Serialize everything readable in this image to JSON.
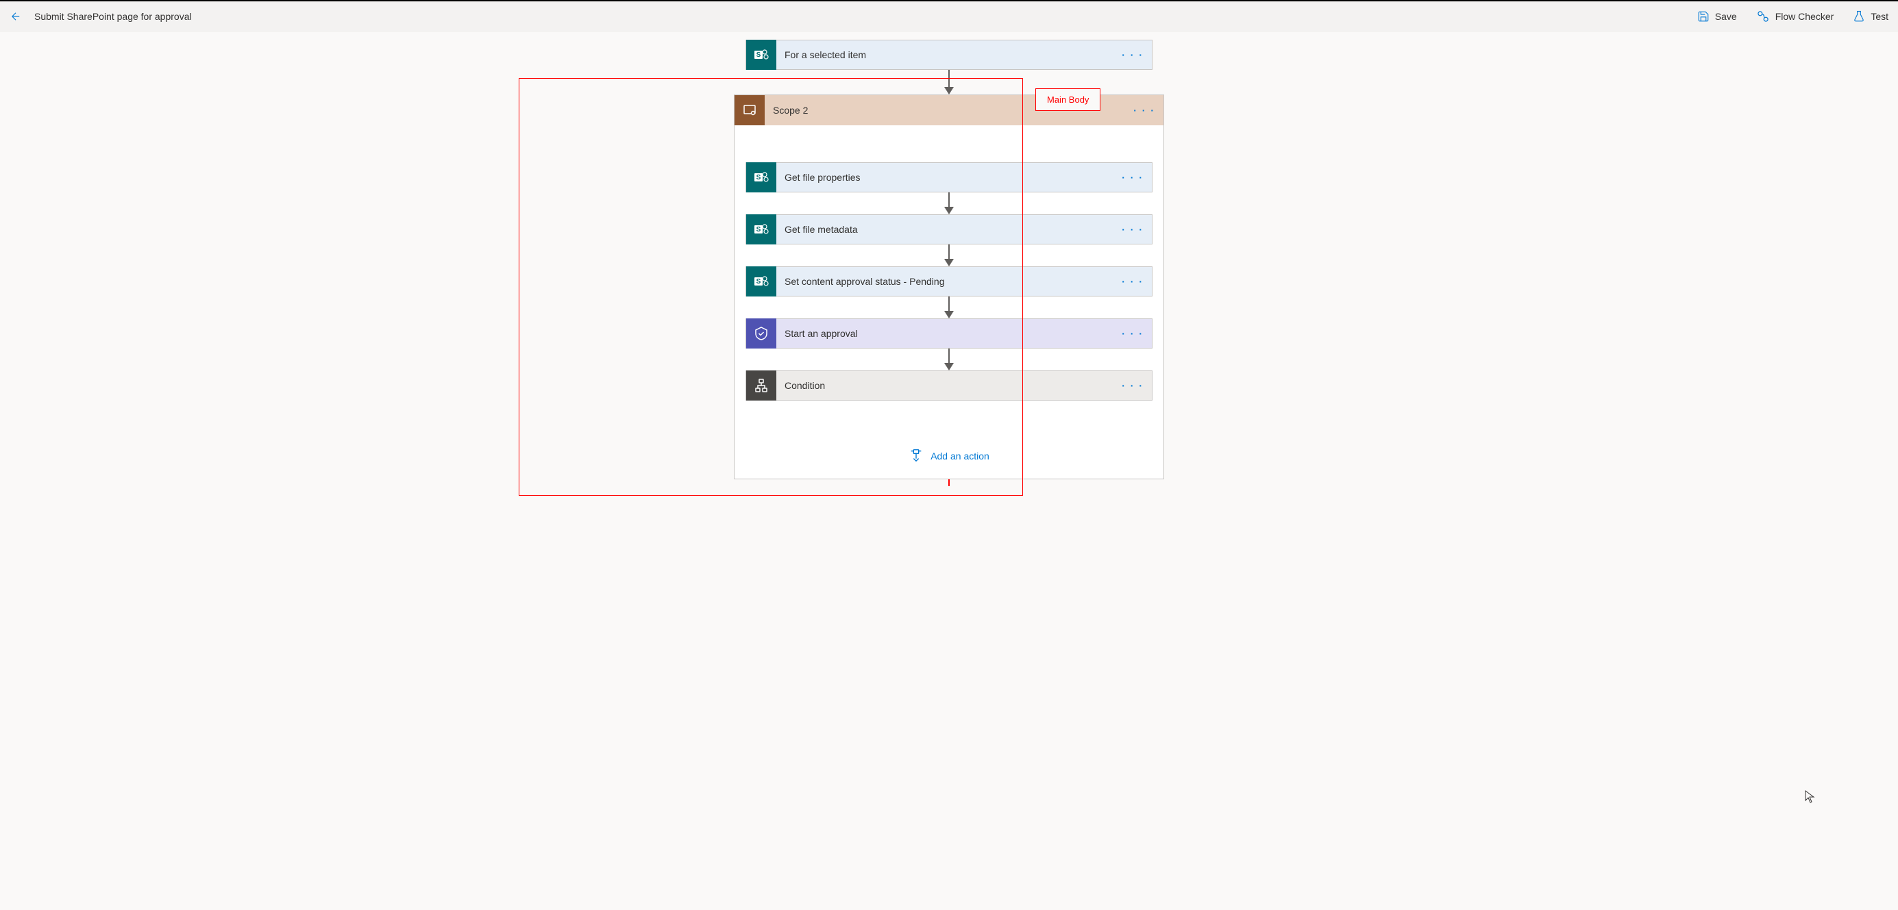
{
  "header": {
    "title": "Submit SharePoint page for approval",
    "actions": {
      "save": "Save",
      "flow_checker": "Flow Checker",
      "test": "Test"
    }
  },
  "flow": {
    "trigger": {
      "label": "For a selected item"
    },
    "scope": {
      "label": "Scope 2",
      "actions": [
        {
          "label": "Get file properties",
          "type": "sharepoint"
        },
        {
          "label": "Get file metadata",
          "type": "sharepoint"
        },
        {
          "label": "Set content approval status - Pending",
          "type": "sharepoint"
        },
        {
          "label": "Start an approval",
          "type": "approval"
        },
        {
          "label": "Condition",
          "type": "condition"
        }
      ],
      "add_action": "Add an action"
    }
  },
  "annotation": {
    "main_body": "Main Body"
  }
}
